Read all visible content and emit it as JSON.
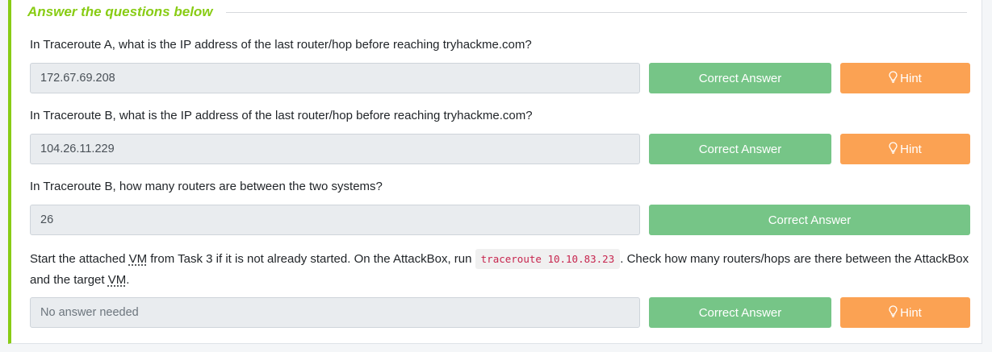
{
  "section": {
    "title": "Answer the questions below"
  },
  "questions": [
    {
      "text": "In Traceroute A, what is the IP address of the last router/hop before reaching tryhackme.com?",
      "answer": "172.67.69.208",
      "correct_label": "Correct Answer",
      "hint_label": "Hint"
    },
    {
      "text": "In Traceroute B, what is the IP address of the last router/hop before reaching tryhackme.com?",
      "answer": "104.26.11.229",
      "correct_label": "Correct Answer",
      "hint_label": "Hint"
    },
    {
      "text": "In Traceroute B, how many routers are between the two systems?",
      "answer": "26",
      "correct_label": "Correct Answer"
    },
    {
      "text_part1": "Start the attached ",
      "abbr1": "VM",
      "text_part2": " from Task 3 if it is not already started. On the AttackBox, run ",
      "code": "traceroute 10.10.83.23",
      "text_part3": ". Check how many routers/hops are there between the AttackBox and the target ",
      "abbr2": "VM",
      "text_part4": ".",
      "answer_placeholder": "No answer needed",
      "correct_label": "Correct Answer",
      "hint_label": "Hint"
    }
  ],
  "colors": {
    "accent": "#88cc14",
    "correct_button": "#76c587",
    "hint_button": "#fba253",
    "code_text": "#c7254e"
  },
  "icons": {
    "hint": "lightbulb-icon"
  }
}
